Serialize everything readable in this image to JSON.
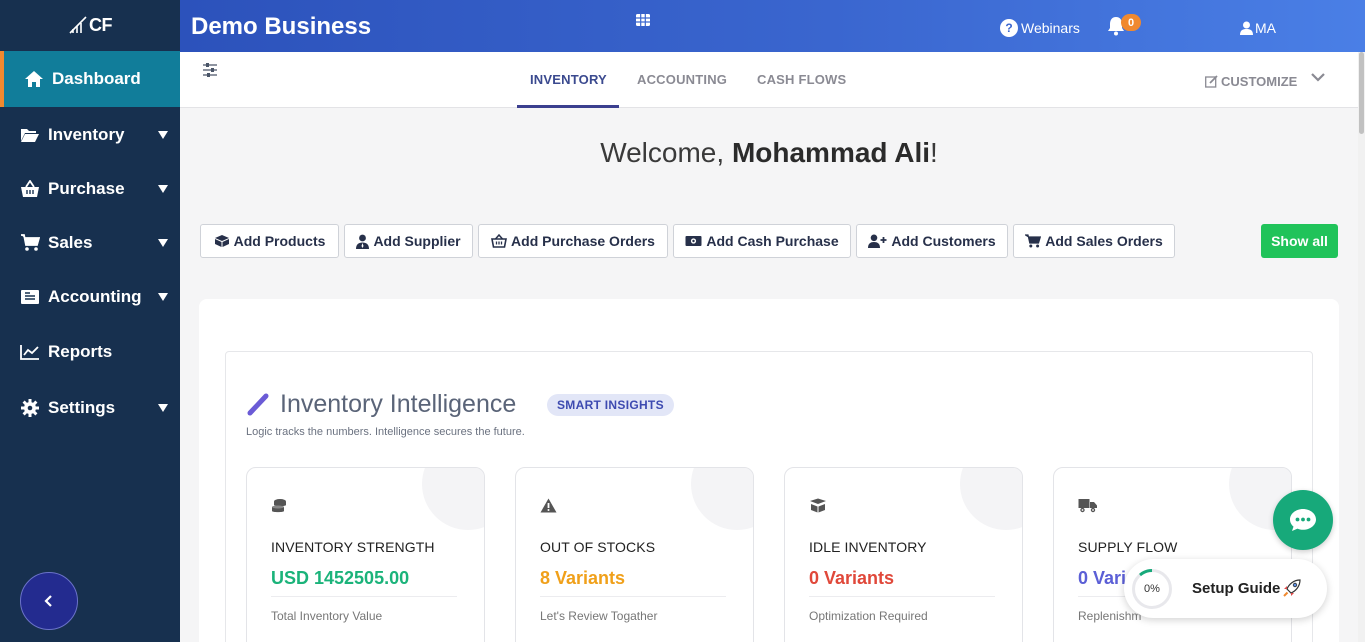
{
  "logo": {
    "text": "CF"
  },
  "sidebar": {
    "items": [
      {
        "label": "Dashboard",
        "icon": "home-icon"
      },
      {
        "label": "Inventory",
        "icon": "folder-open-icon"
      },
      {
        "label": "Purchase",
        "icon": "basket-icon"
      },
      {
        "label": "Sales",
        "icon": "cart-icon"
      },
      {
        "label": "Accounting",
        "icon": "ledger-icon"
      },
      {
        "label": "Reports",
        "icon": "line-chart-icon"
      },
      {
        "label": "Settings",
        "icon": "gear-icon"
      }
    ]
  },
  "topbar": {
    "business_name": "Demo Business",
    "webinars_label": "Webinars",
    "notification_count": "0",
    "user_initials": "MA"
  },
  "tabs": {
    "items": [
      "INVENTORY",
      "ACCOUNTING",
      "CASH FLOWS"
    ],
    "active": "INVENTORY",
    "customize_label": "CUSTOMIZE"
  },
  "welcome": {
    "greeting": "Welcome, ",
    "name": "Mohammad Ali",
    "suffix": "!"
  },
  "quick_actions": {
    "buttons": [
      "Add Products",
      "Add Supplier",
      "Add Purchase Orders",
      "Add Cash Purchase",
      "Add Customers",
      "Add Sales Orders"
    ],
    "show_all_label": "Show all"
  },
  "intelligence": {
    "title": "Inventory Intelligence",
    "badge": "SMART INSIGHTS",
    "subtitle": "Logic tracks the numbers. Intelligence secures the future.",
    "cards": [
      {
        "title": "INVENTORY STRENGTH",
        "value": "USD 1452505.00",
        "value_color": "#1bb37a",
        "note": "Total Inventory Value",
        "icon": "coins-icon"
      },
      {
        "title": "OUT OF STOCKS",
        "value": "8 Variants",
        "value_color": "#f0a01a",
        "note": "Let's Review Togather",
        "icon": "warning-icon"
      },
      {
        "title": "IDLE INVENTORY",
        "value": "0 Variants",
        "value_color": "#e0483a",
        "note": "Optimization Required",
        "icon": "box-open-icon"
      },
      {
        "title": "SUPPLY FLOW",
        "value": "0 Vari",
        "value_color": "#5b5fd6",
        "note": "Replenishm",
        "icon": "truck-icon"
      }
    ]
  },
  "setup_guide": {
    "progress": "0%",
    "label": "Setup Guide"
  },
  "colors": {
    "sidebar_bg": "#17304f",
    "active_item": "#117d9a",
    "accent_orange": "#f0892f",
    "show_all_green": "#20c35a",
    "chat_green": "#17a97a"
  }
}
